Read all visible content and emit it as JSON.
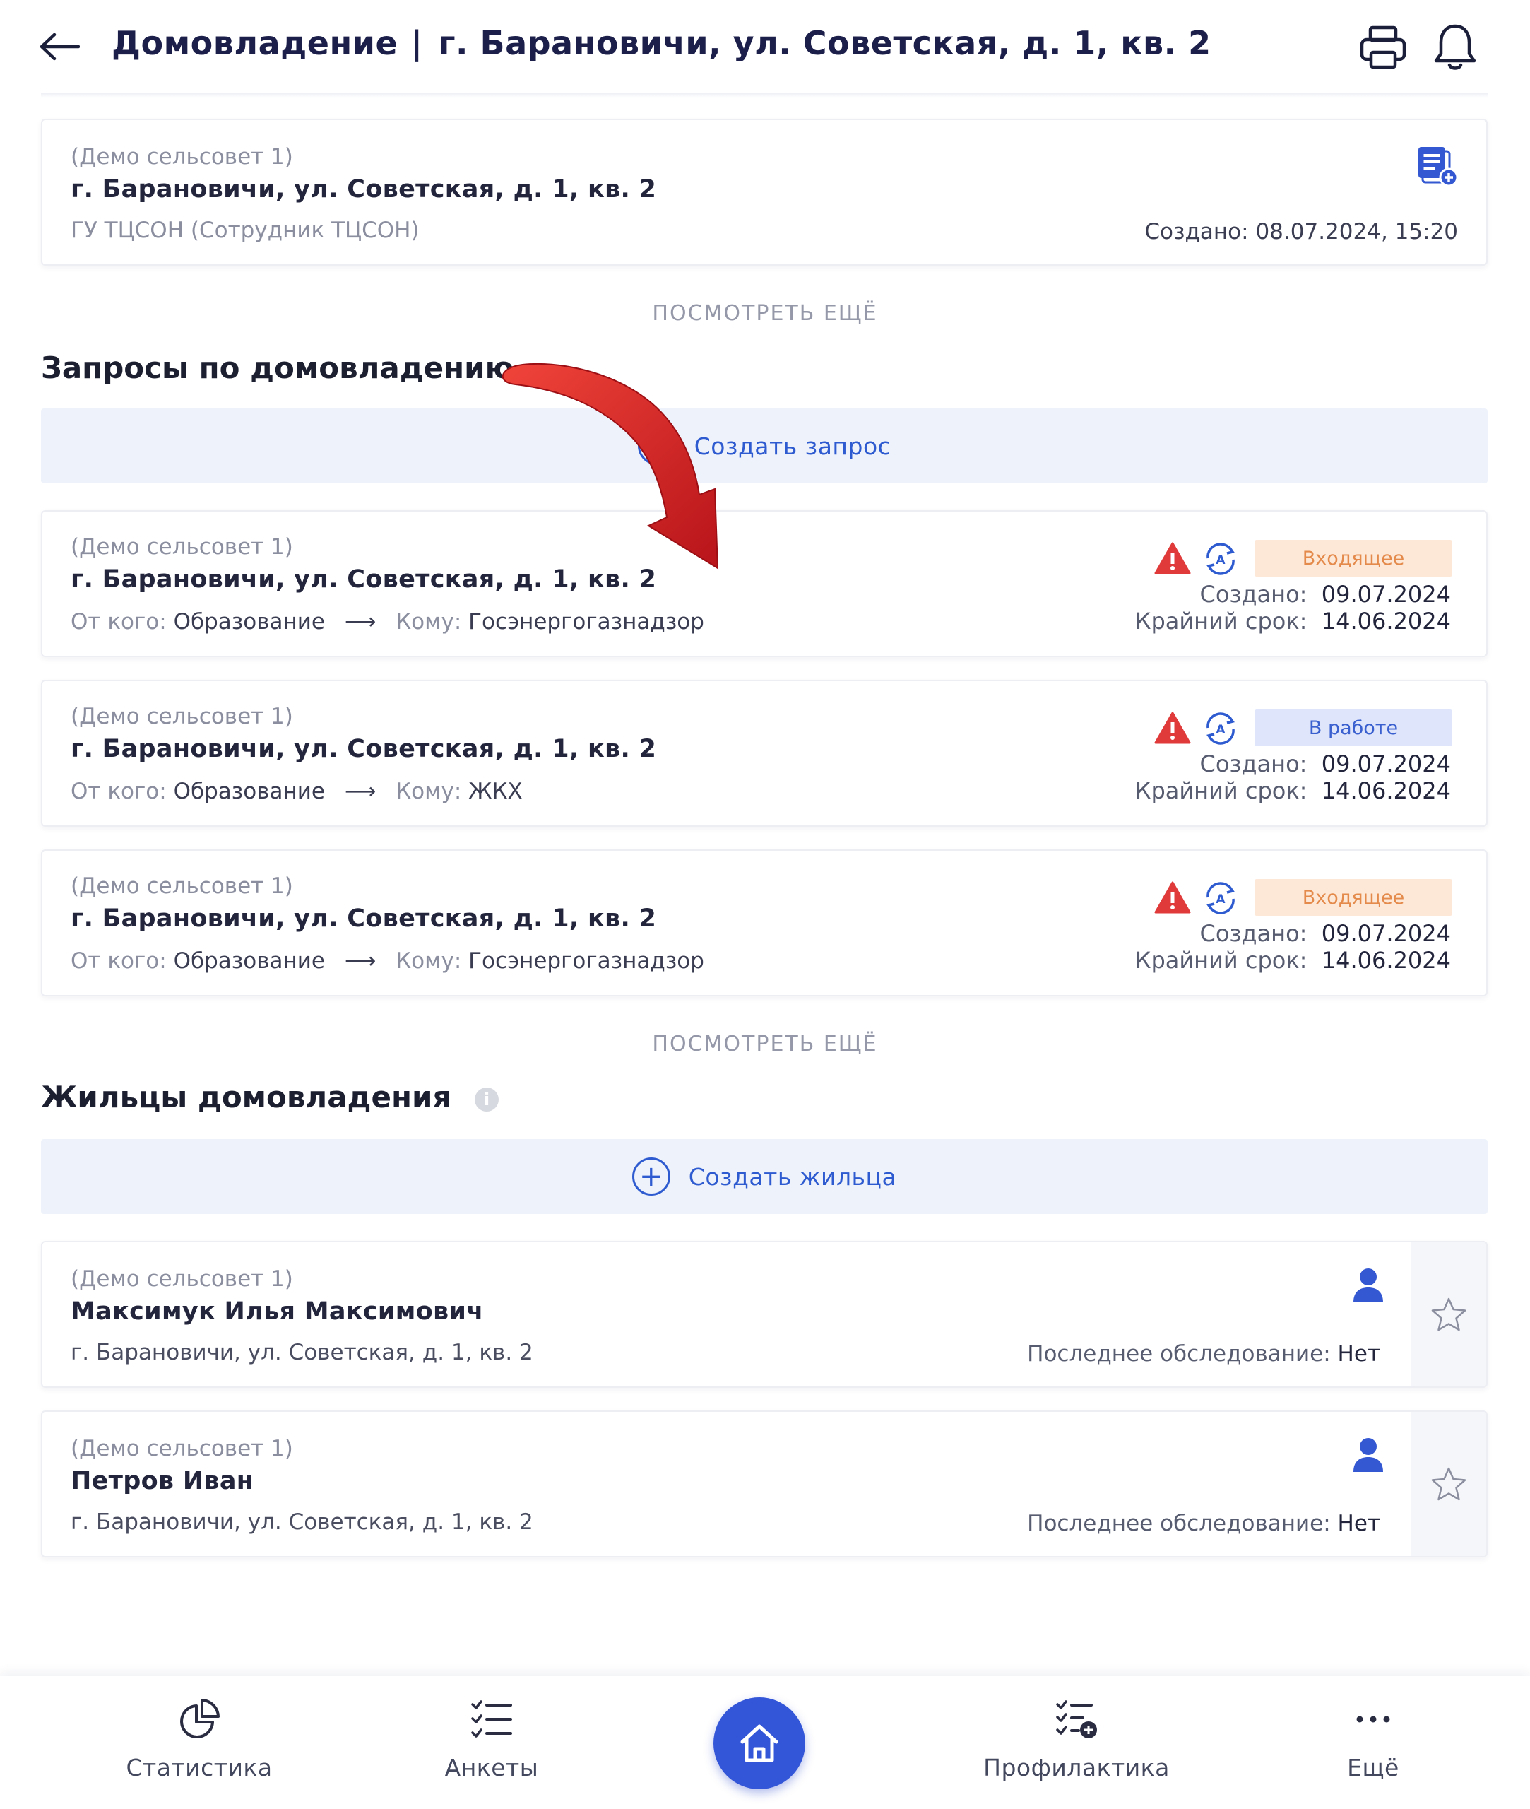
{
  "header": {
    "title_main": "Домовладение",
    "title_sep": "|",
    "title_address": "г. Барановичи, ул. Советская, д. 1, кв. 2"
  },
  "top_card": {
    "org": "(Демо сельсовет 1)",
    "address": "г. Барановичи, ул. Советская, д. 1, кв. 2",
    "author": "ГУ ТЦСОН (Сотрудник ТЦСОН)",
    "created": "Создано: 08.07.2024, 15:20"
  },
  "see_more_1": "ПОСМОТРЕТЬ ЕЩЁ",
  "requests": {
    "title": "Запросы по домовладению",
    "create_label": "Создать запрос",
    "items": [
      {
        "org": "(Демо сельсовет 1)",
        "address": "г. Барановичи, ул. Советская, д. 1, кв. 2",
        "from_label": "От кого:",
        "from": "Образование",
        "arrow": "⟶",
        "to_label": "Кому:",
        "to": "Госэнергогазнадзор",
        "status": "Входящее",
        "created_label": "Создано:",
        "created": "09.07.2024",
        "deadline_label": "Крайний срок:",
        "deadline": "14.06.2024"
      },
      {
        "org": "(Демо сельсовет 1)",
        "address": "г. Барановичи, ул. Советская, д. 1, кв. 2",
        "from_label": "От кого:",
        "from": "Образование",
        "arrow": "⟶",
        "to_label": "Кому:",
        "to": "ЖКХ",
        "status": "В работе",
        "created_label": "Создано:",
        "created": "09.07.2024",
        "deadline_label": "Крайний срок:",
        "deadline": "14.06.2024"
      },
      {
        "org": "(Демо сельсовет 1)",
        "address": "г. Барановичи, ул. Советская, д. 1, кв. 2",
        "from_label": "От кого:",
        "from": "Образование",
        "arrow": "⟶",
        "to_label": "Кому:",
        "to": "Госэнергогазнадзор",
        "status": "Входящее",
        "created_label": "Создано:",
        "created": "09.07.2024",
        "deadline_label": "Крайний срок:",
        "deadline": "14.06.2024"
      }
    ]
  },
  "see_more_2": "ПОСМОТРЕТЬ ЕЩЁ",
  "residents": {
    "title": "Жильцы домовладения",
    "create_label": "Создать жильца",
    "items": [
      {
        "org": "(Демо сельсовет 1)",
        "name": "Максимук Илья Максимович",
        "address": "г. Барановичи, ул. Советская, д. 1, кв. 2",
        "last_exam_label": "Последнее обследование:",
        "last_exam": "Нет"
      },
      {
        "org": "(Демо сельсовет 1)",
        "name": "Петров Иван",
        "address": "г. Барановичи, ул. Советская, д. 1, кв. 2",
        "last_exam_label": "Последнее обследование:",
        "last_exam": "Нет"
      }
    ]
  },
  "nav": {
    "statistics": "Статистика",
    "forms": "Анкеты",
    "prevention": "Профилактика",
    "more": "Ещё"
  },
  "colors": {
    "accent": "#3356d8",
    "incoming_bg": "#fde8d8",
    "incoming_text": "#e48a4a",
    "working_bg": "#dfe6fb",
    "working_text": "#3a5fcf",
    "warning": "#e53935"
  }
}
